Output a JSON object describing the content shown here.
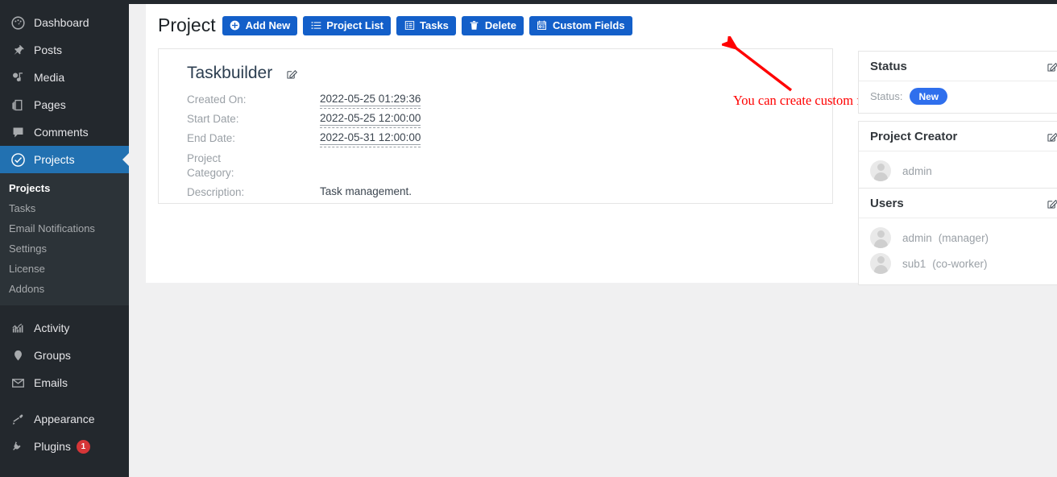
{
  "colors": {
    "sidebar_bg": "#23282d",
    "sidebar_submenu_bg": "#2c3338",
    "sidebar_active": "#2271b1",
    "page_bg": "#f0f0f1",
    "button_blue": "#135fc9",
    "status_pill": "#2f6fed",
    "badge_red": "#d63638",
    "annotation_red": "#ff0000"
  },
  "sidebar": {
    "items": [
      {
        "label": "Dashboard",
        "icon": "dashboard-icon"
      },
      {
        "label": "Posts",
        "icon": "pin-icon"
      },
      {
        "label": "Media",
        "icon": "media-icon"
      },
      {
        "label": "Pages",
        "icon": "pages-icon"
      },
      {
        "label": "Comments",
        "icon": "comments-icon"
      },
      {
        "label": "Projects",
        "icon": "check-circle-icon"
      }
    ],
    "submenu": [
      {
        "label": "Projects",
        "active": true
      },
      {
        "label": "Tasks",
        "active": false
      },
      {
        "label": "Email Notifications",
        "active": false
      },
      {
        "label": "Settings",
        "active": false
      },
      {
        "label": "License",
        "active": false
      },
      {
        "label": "Addons",
        "active": false
      }
    ],
    "group2": [
      {
        "label": "Activity",
        "icon": "activity-icon"
      },
      {
        "label": "Groups",
        "icon": "groups-icon"
      },
      {
        "label": "Emails",
        "icon": "envelope-icon"
      }
    ],
    "group3": [
      {
        "label": "Appearance",
        "icon": "brush-icon",
        "badge": ""
      },
      {
        "label": "Plugins",
        "icon": "plug-icon",
        "badge": "1"
      }
    ]
  },
  "header": {
    "title": "Project",
    "buttons": [
      {
        "label": "Add New",
        "icon": "plus-circle-icon"
      },
      {
        "label": "Project List",
        "icon": "list-icon"
      },
      {
        "label": "Tasks",
        "icon": "list-alt-icon"
      },
      {
        "label": "Delete",
        "icon": "trash-icon"
      },
      {
        "label": "Custom Fields",
        "icon": "custom-fields-icon"
      }
    ]
  },
  "project": {
    "name": "Taskbuilder",
    "edit_icon": "edit-pencil-icon",
    "fields": [
      {
        "label": "Created On:",
        "value": "2022-05-25 01:29:36",
        "editable": true
      },
      {
        "label": "Start Date:",
        "value": "2022-05-25 12:00:00",
        "editable": true
      },
      {
        "label": "End Date:",
        "value": "2022-05-31 12:00:00",
        "editable": true
      },
      {
        "label": "Project Category:",
        "value": "",
        "editable": false
      },
      {
        "label": "Description:",
        "value": "Task management.",
        "editable": false
      }
    ]
  },
  "panels": {
    "status": {
      "title": "Status",
      "edit_icon": "edit-pencil-icon",
      "key": "Status:",
      "value": "New"
    },
    "creator": {
      "title": "Project Creator",
      "edit_icon": "edit-pencil-icon",
      "user": {
        "name": "admin",
        "role": ""
      }
    },
    "users": {
      "title": "Users",
      "edit_icon": "edit-pencil-icon",
      "list": [
        {
          "name": "admin",
          "role": "(manager)"
        },
        {
          "name": "sub1",
          "role": "(co-worker)"
        }
      ]
    }
  },
  "annotation": {
    "text": "You can create custom fields.",
    "arrow_icon": "red-arrow-icon"
  }
}
